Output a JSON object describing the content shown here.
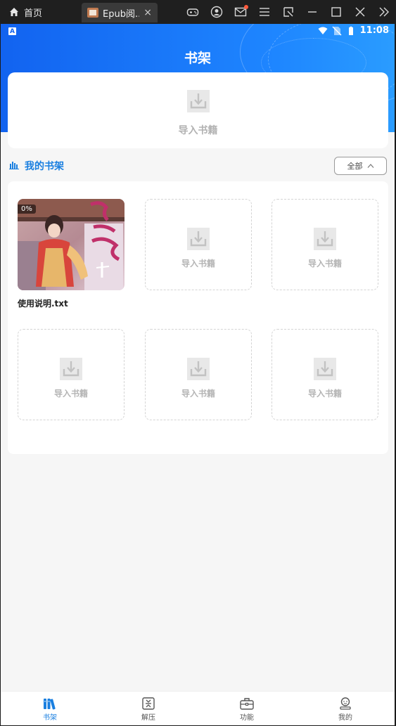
{
  "emulator": {
    "home_tab_label": "首页",
    "app_tab_label": "Epub阅...",
    "tab_close": "×",
    "toolbar_icons": [
      "gamepad-icon",
      "user-icon",
      "mail-icon",
      "menu-icon",
      "resize-icon",
      "minimize-icon",
      "maximize-icon",
      "close-icon",
      "double-chevron-icon"
    ]
  },
  "status_bar": {
    "badge": "A",
    "time": "11:08"
  },
  "header": {
    "title": "书架"
  },
  "import_card": {
    "label": "导入书籍"
  },
  "shelf": {
    "title": "我的书架",
    "filter_label": "全部",
    "book": {
      "progress": "0%",
      "title": "使用说明.txt"
    },
    "slots": [
      {
        "label": "导入书籍"
      },
      {
        "label": "导入书籍"
      },
      {
        "label": "导入书籍"
      },
      {
        "label": "导入书籍"
      },
      {
        "label": "导入书籍"
      }
    ]
  },
  "bottom_nav": [
    {
      "label": "书架",
      "icon": "bookshelf-icon",
      "active": true
    },
    {
      "label": "解压",
      "icon": "unzip-icon",
      "active": false
    },
    {
      "label": "功能",
      "icon": "toolbox-icon",
      "active": false
    },
    {
      "label": "我的",
      "icon": "profile-icon",
      "active": false
    }
  ],
  "colors": {
    "accent": "#1a7fe0",
    "hero_start": "#1263f0",
    "hero_end": "#2a9cff",
    "placeholder_text": "#b4b4b4"
  }
}
